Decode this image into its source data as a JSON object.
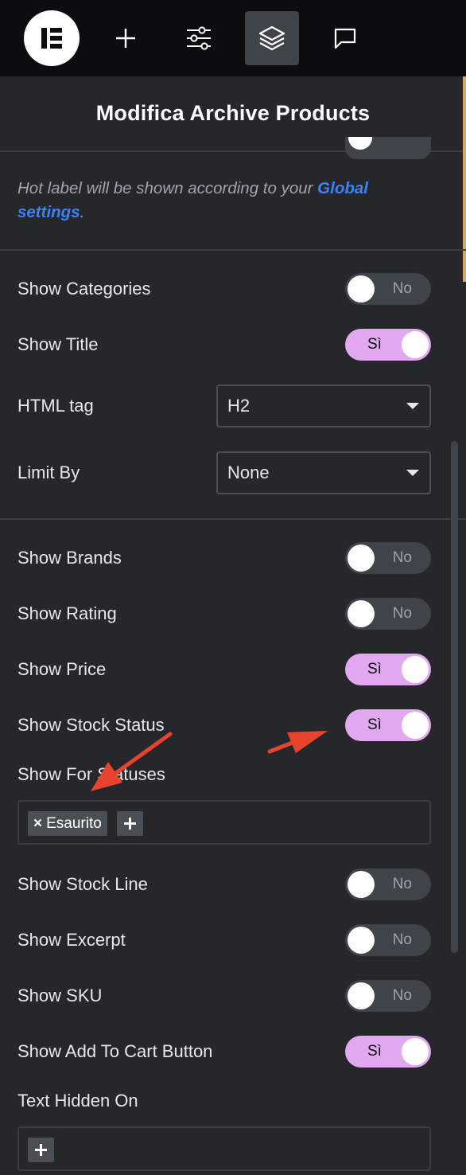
{
  "toolbar": {
    "icons": [
      "elementor-logo-icon",
      "plus-icon",
      "sliders-icon",
      "layers-icon",
      "chat-icon"
    ],
    "active": "layers-icon"
  },
  "panel": {
    "title": "Modifica Archive Products"
  },
  "note": {
    "prefix": "Hot label will be shown according to your ",
    "link": "Global settings",
    "suffix": "."
  },
  "controls": {
    "show_categories": {
      "label": "Show Categories",
      "state": "No"
    },
    "show_title": {
      "label": "Show Title",
      "state": "Sì"
    },
    "html_tag": {
      "label": "HTML tag",
      "value": "H2"
    },
    "limit_by": {
      "label": "Limit By",
      "value": "None"
    },
    "show_brands": {
      "label": "Show Brands",
      "state": "No"
    },
    "show_rating": {
      "label": "Show Rating",
      "state": "No"
    },
    "show_price": {
      "label": "Show Price",
      "state": "Sì"
    },
    "show_stock_status": {
      "label": "Show Stock Status",
      "state": "Sì"
    },
    "show_for_statuses": {
      "label": "Show For Statuses",
      "tags": [
        "Esaurito"
      ],
      "tag_remove": "×"
    },
    "show_stock_line": {
      "label": "Show Stock Line",
      "state": "No"
    },
    "show_excerpt": {
      "label": "Show Excerpt",
      "state": "No"
    },
    "show_sku": {
      "label": "Show SKU",
      "state": "No"
    },
    "show_add_to_cart": {
      "label": "Show Add To Cart Button",
      "state": "Sì"
    },
    "text_hidden_on": {
      "label": "Text Hidden On",
      "tags": []
    }
  },
  "colors": {
    "toggle_on": "#e2a9f1",
    "toggle_off": "#3f444b",
    "link": "#3b82f6",
    "annotation_arrow": "#e8432d"
  }
}
